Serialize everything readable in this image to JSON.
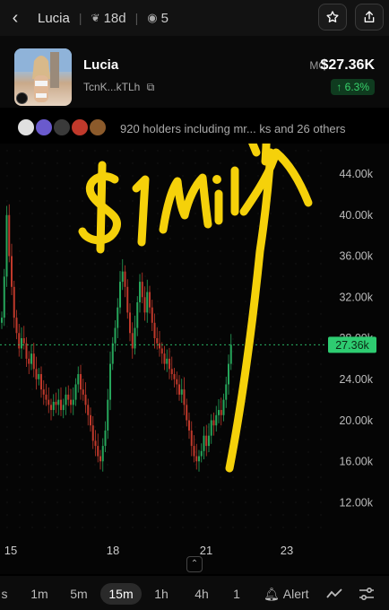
{
  "topbar": {
    "back_icon": "chevron-left-icon",
    "title": "Lucia",
    "age": "18d",
    "views": "5",
    "star_icon": "star-icon",
    "share_icon": "share-icon"
  },
  "token": {
    "name": "Lucia",
    "address": "TcnK...kTLh",
    "mc_label": "MC",
    "mc_value": "$27.36K",
    "change": "↑ 6.3%"
  },
  "holders": {
    "text": "920 holders including mr... ks and 26 others"
  },
  "chart_data": {
    "type": "candlestick",
    "y_ticks": [
      "44.00k",
      "40.00k",
      "36.00k",
      "32.00k",
      "28.00k",
      "24.00k",
      "20.00k",
      "16.00k",
      "12.00k"
    ],
    "x_ticks": [
      "15",
      "18",
      "21",
      "23"
    ],
    "current_price_label": "27.36k",
    "ylim": [
      10000,
      46000
    ],
    "annotation": "$1 mil"
  },
  "timeframes": [
    "s",
    "1m",
    "5m",
    "15m",
    "1h",
    "4h",
    "1"
  ],
  "active_timeframe": "15m",
  "bottom": {
    "alert_label": "Alert"
  },
  "colors": {
    "up": "#26a65b",
    "down": "#c0392b",
    "price_line": "#2ecc71",
    "annotation": "#f5d10a"
  }
}
